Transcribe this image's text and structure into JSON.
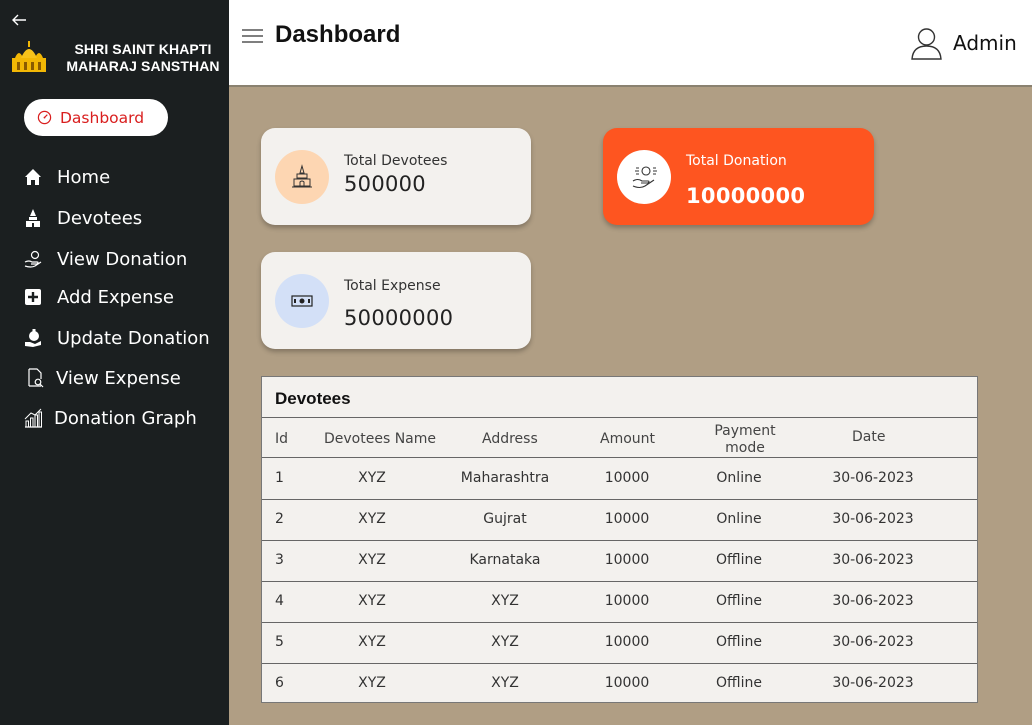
{
  "brand": {
    "line1": "SHRI SAINT KHAPTI",
    "line2": "MAHARAJ SANSTHAN"
  },
  "sidebar": {
    "active": "Dashboard",
    "items": [
      {
        "label": "Home",
        "icon": "home-icon"
      },
      {
        "label": "Devotees",
        "icon": "temple-icon"
      },
      {
        "label": "View Donation",
        "icon": "donation-hand-icon"
      },
      {
        "label": "Add Expense",
        "icon": "plus-square-icon"
      },
      {
        "label": "Update Donation",
        "icon": "money-bag-hand-icon"
      },
      {
        "label": "View Expense",
        "icon": "document-search-icon"
      },
      {
        "label": "Donation Graph",
        "icon": "bar-graph-icon"
      }
    ]
  },
  "header": {
    "title": "Dashboard",
    "user": "Admin"
  },
  "cards": {
    "devotees": {
      "label": "Total Devotees",
      "value": "500000"
    },
    "donation": {
      "label": "Total Donation",
      "value": "10000000"
    },
    "expense": {
      "label": "Total Expense",
      "value": "50000000"
    }
  },
  "table": {
    "title": "Devotees",
    "headers": [
      "Id",
      "Devotees Name",
      "Address",
      "Amount",
      "Payment\nmode",
      "Date"
    ],
    "rows": [
      [
        "1",
        "XYZ",
        "Maharashtra",
        "10000",
        "Online",
        "30-06-2023"
      ],
      [
        "2",
        "XYZ",
        "Gujrat",
        "10000",
        "Online",
        "30-06-2023"
      ],
      [
        "3",
        "XYZ",
        "Karnataka",
        "10000",
        "Offline",
        "30-06-2023"
      ],
      [
        "4",
        "XYZ",
        "XYZ",
        "10000",
        "Offline",
        "30-06-2023"
      ],
      [
        "5",
        "XYZ",
        "XYZ",
        "10000",
        "Offline",
        "30-06-2023"
      ],
      [
        "6",
        "XYZ",
        "XYZ",
        "10000",
        "Offline",
        "30-06-2023"
      ]
    ]
  },
  "colors": {
    "sidebar": "#1b1f20",
    "background": "#b09e84",
    "accent_orange": "#fe5520",
    "active_red": "#d91e1e"
  }
}
